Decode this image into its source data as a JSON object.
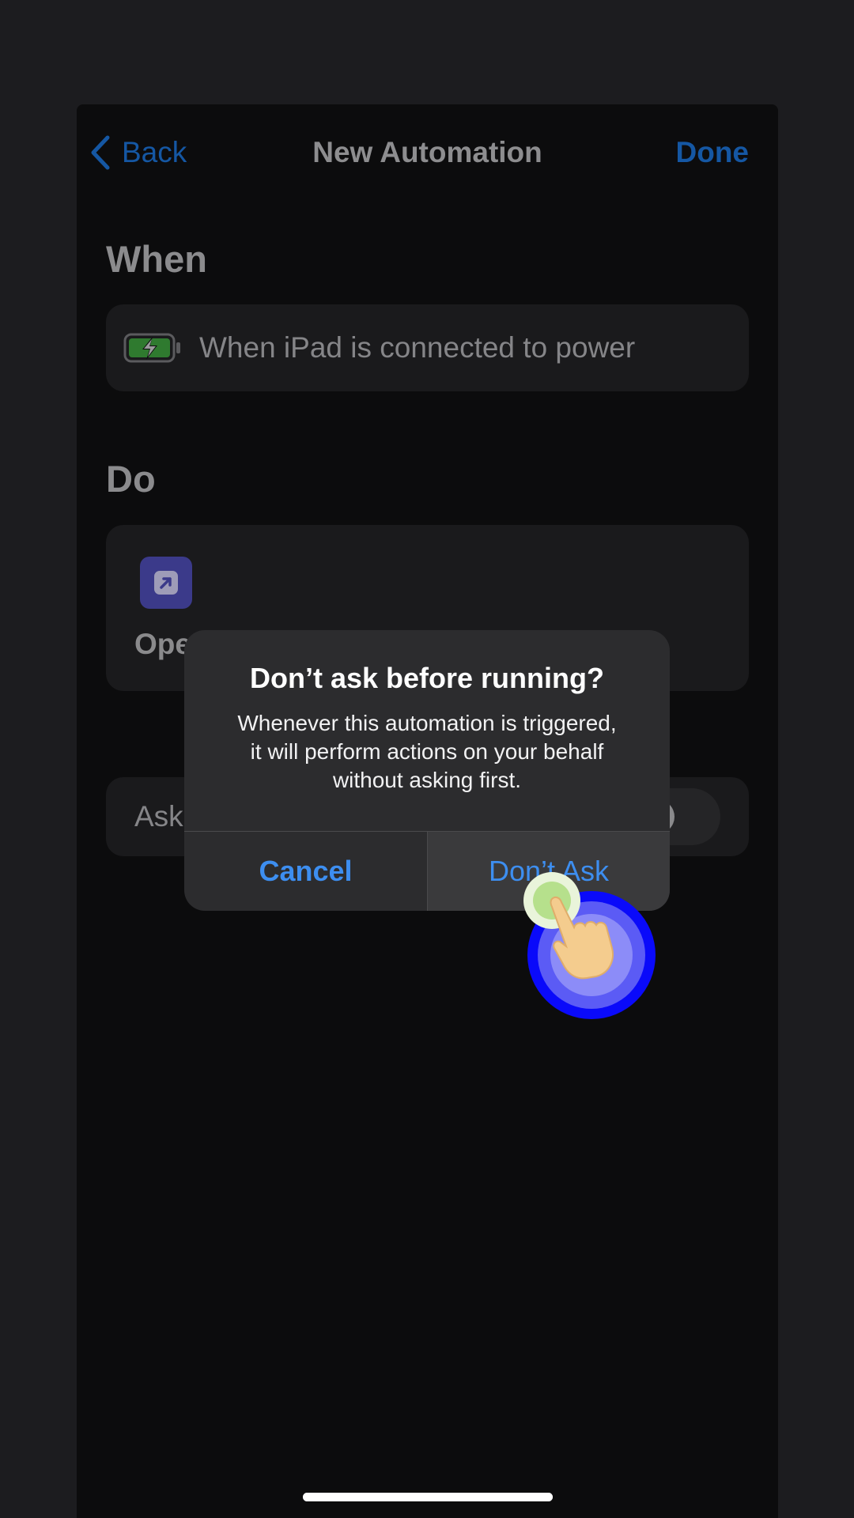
{
  "nav": {
    "back_label": "Back",
    "title": "New Automation",
    "done_label": "Done"
  },
  "when_section": {
    "heading": "When",
    "trigger": "When iPad is connected to power"
  },
  "do_section": {
    "heading": "Do",
    "action_label": "Ope"
  },
  "ask_row": {
    "label": "Ask"
  },
  "dialog": {
    "title": "Don’t ask before running?",
    "message_line1": "Whenever this automation is triggered,",
    "message_line2": "it will perform actions on your behalf",
    "message_line3": "without asking first.",
    "cancel_label": "Cancel",
    "confirm_label": "Don’t Ask"
  },
  "colors": {
    "accent": "#3d8ef0",
    "dim_accent": "#1557a3",
    "tap_ring": "#0a0afa"
  }
}
